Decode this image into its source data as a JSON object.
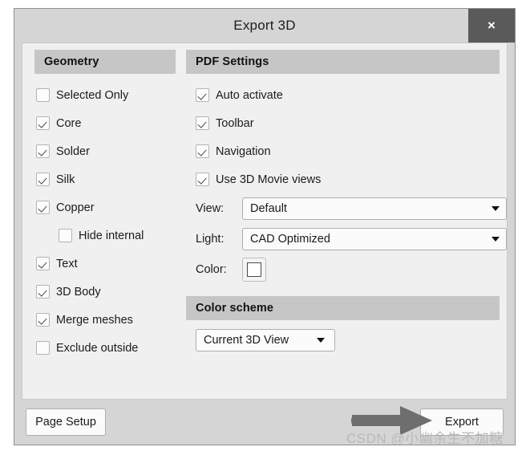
{
  "window": {
    "title": "Export 3D",
    "close_label": "×"
  },
  "geometry": {
    "header": "Geometry",
    "items": [
      {
        "label": "Selected Only",
        "checked": false,
        "indent": false
      },
      {
        "label": "Core",
        "checked": true,
        "indent": false
      },
      {
        "label": "Solder",
        "checked": true,
        "indent": false
      },
      {
        "label": "Silk",
        "checked": true,
        "indent": false
      },
      {
        "label": "Copper",
        "checked": true,
        "indent": false
      },
      {
        "label": "Hide internal",
        "checked": false,
        "indent": true
      },
      {
        "label": "Text",
        "checked": true,
        "indent": false
      },
      {
        "label": "3D Body",
        "checked": true,
        "indent": false
      },
      {
        "label": "Merge meshes",
        "checked": true,
        "indent": false
      },
      {
        "label": "Exclude outside",
        "checked": false,
        "indent": false
      }
    ]
  },
  "pdf_settings": {
    "header": "PDF Settings",
    "items": [
      {
        "label": "Auto activate",
        "checked": true
      },
      {
        "label": "Toolbar",
        "checked": true
      },
      {
        "label": "Navigation",
        "checked": true
      },
      {
        "label": "Use 3D Movie views",
        "checked": true
      }
    ],
    "view": {
      "label": "View:",
      "value": "Default"
    },
    "light": {
      "label": "Light:",
      "value": "CAD Optimized"
    },
    "color": {
      "label": "Color:",
      "swatch_hex": "#ffffff"
    }
  },
  "color_scheme": {
    "header": "Color scheme",
    "value": "Current 3D View"
  },
  "footer": {
    "page_setup_label": "Page Setup",
    "export_label": "Export"
  },
  "annotation": {
    "arrow_color": "#6e6e6e",
    "watermark": "CSDN @小幽余生不加糖"
  }
}
